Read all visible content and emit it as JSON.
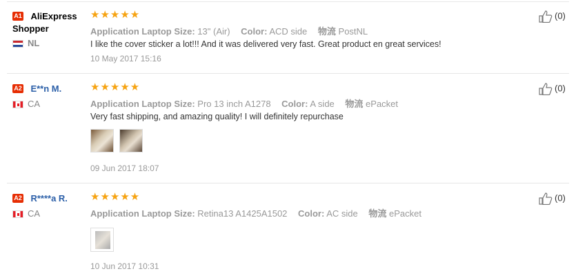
{
  "reviews": [
    {
      "badge": "A1",
      "name": "AliExpress Shopper",
      "country": "NL",
      "stars": "★★★★★",
      "size_label": "Application Laptop Size:",
      "size_value": "13\" (Air)",
      "color_label": "Color:",
      "color_value": "ACD side",
      "ship_label": "物流",
      "ship_value": "PostNL",
      "text": "I like the cover sticker a lot!!! And it was delivered very fast. Great product en great services!",
      "date": "10 May 2017 15:16",
      "likes": "(0)"
    },
    {
      "badge": "A2",
      "name": "E**n M.",
      "country": "CA",
      "stars": "★★★★★",
      "size_label": "Application Laptop Size:",
      "size_value": "Pro 13 inch A1278",
      "color_label": "Color:",
      "color_value": "A side",
      "ship_label": "物流",
      "ship_value": "ePacket",
      "text": "Very fast shipping, and amazing quality! I will definitely repurchase",
      "date": "09 Jun 2017 18:07",
      "likes": "(0)"
    },
    {
      "badge": "A2",
      "name": "R****a R.",
      "country": "CA",
      "stars": "★★★★★",
      "size_label": "Application Laptop Size:",
      "size_value": "Retina13 A1425A1502",
      "color_label": "Color:",
      "color_value": "AC side",
      "ship_label": "物流",
      "ship_value": "ePacket",
      "date": "10 Jun 2017 10:31",
      "likes": "(0)"
    }
  ],
  "colors": {
    "star": "#f6a312",
    "badge": "#e62e04",
    "name_blue": "#2b5fa8"
  },
  "icons": {
    "like": "thumbs-up-icon",
    "star": "star-icon"
  }
}
